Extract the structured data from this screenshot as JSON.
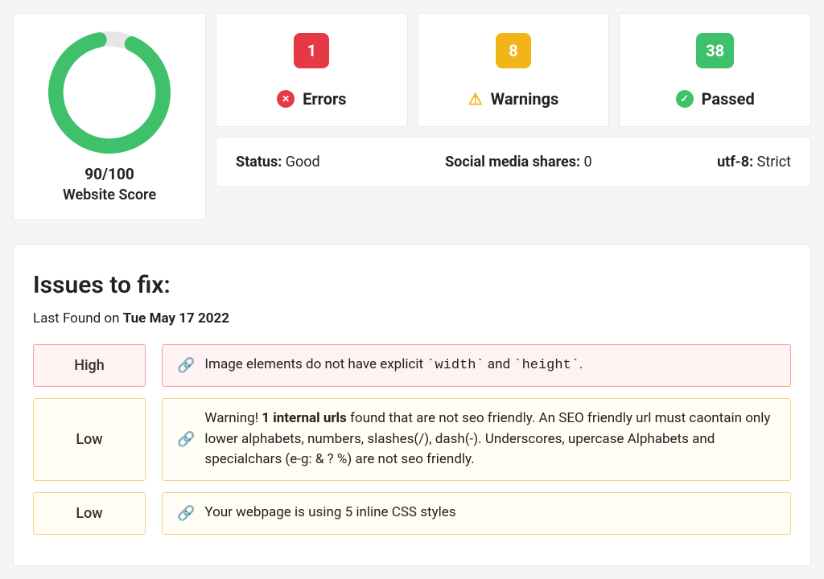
{
  "score": {
    "value": "90/100",
    "label": "Website Score",
    "pct": 90
  },
  "stats": {
    "errors": {
      "count": "1",
      "label": "Errors"
    },
    "warnings": {
      "count": "8",
      "label": "Warnings"
    },
    "passed": {
      "count": "38",
      "label": "Passed"
    }
  },
  "status_bar": {
    "status_label": "Status:",
    "status_value": " Good",
    "social_label": "Social media shares:",
    "social_value": " 0",
    "enc_label": "utf-8:",
    "enc_value": " Strict"
  },
  "issues": {
    "title": "Issues to fix:",
    "last_found_prefix": "Last Found on ",
    "last_found_date": "Tue May 17 2022",
    "items": [
      {
        "severity": "High",
        "level": "high",
        "text": "Image elements do not have explicit `width` and `height`."
      },
      {
        "severity": "Low",
        "level": "low",
        "bold_prefix": "Warning! ",
        "bold": "1 internal urls",
        "text": " found that are not seo friendly. An SEO friendly url must caontain only lower alphabets, numbers, slashes(/), dash(-). Underscores, upercase Alphabets and specialchars (e-g: & ? %) are not seo friendly."
      },
      {
        "severity": "Low",
        "level": "low",
        "text": "Your webpage is using 5 inline CSS styles"
      }
    ]
  }
}
